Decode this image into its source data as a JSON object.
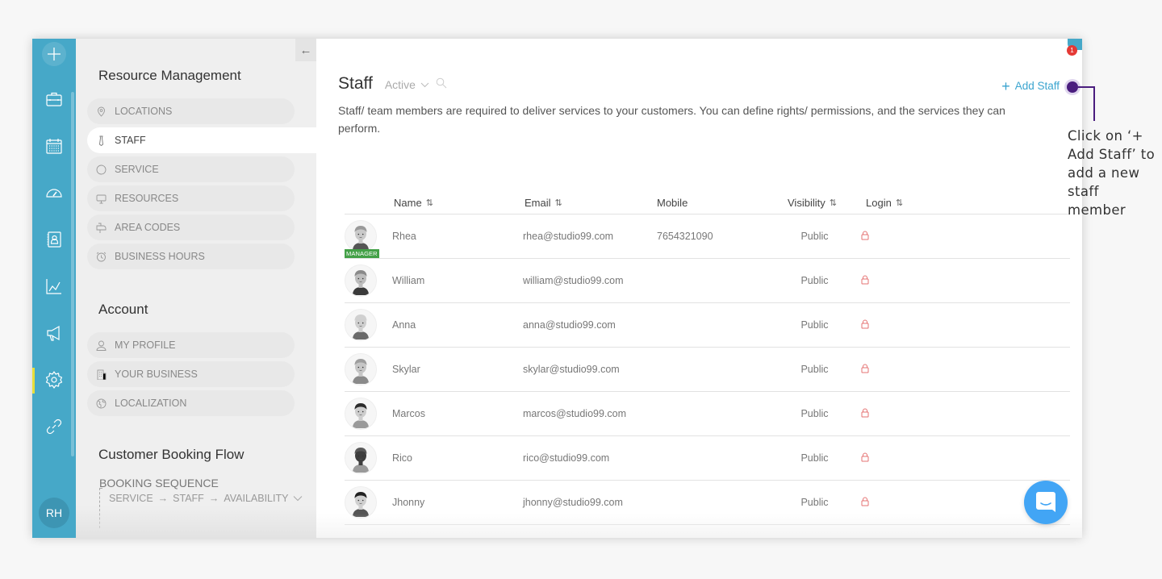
{
  "rail": {
    "items": [
      {
        "name": "briefcase-icon"
      },
      {
        "name": "calendar-icon"
      },
      {
        "name": "dashboard-icon"
      },
      {
        "name": "contacts-icon"
      },
      {
        "name": "analytics-icon"
      },
      {
        "name": "megaphone-icon"
      },
      {
        "name": "settings-icon",
        "active": true
      },
      {
        "name": "link-icon"
      }
    ],
    "user_initials": "RH",
    "active_color": "#e7de3a",
    "bg_color": "#46a8c8"
  },
  "panel": {
    "collapse_icon": "←",
    "resource_title": "Resource Management",
    "resource_items": [
      {
        "label": "LOCATIONS",
        "icon": "location-pin-icon"
      },
      {
        "label": "STAFF",
        "icon": "tie-icon",
        "active": true
      },
      {
        "label": "SERVICE",
        "icon": "circle-icon"
      },
      {
        "label": "RESOURCES",
        "icon": "monitor-icon"
      },
      {
        "label": "AREA CODES",
        "icon": "mailbox-icon"
      },
      {
        "label": "BUSINESS HOURS",
        "icon": "alarm-clock-icon"
      }
    ],
    "account_title": "Account",
    "account_items": [
      {
        "label": "MY PROFILE",
        "icon": "user-icon"
      },
      {
        "label": "YOUR BUSINESS",
        "icon": "building-icon"
      },
      {
        "label": "LOCALIZATION",
        "icon": "globe-icon"
      }
    ],
    "flow_title": "Customer Booking Flow",
    "booking_sequence_label": "BOOKING SEQUENCE",
    "sequence": [
      "SERVICE",
      "STAFF",
      "AVAILABILITY"
    ],
    "arrow": "→"
  },
  "main": {
    "title": "Staff",
    "status_filter": "Active",
    "description": "Staff/ team members are required to deliver services to your customers. You can define rights/ permissions, and the services they can perform.",
    "add_staff_plus": "+",
    "add_staff_label": "Add Staff",
    "notification_count": "1",
    "accent_color": "#3aa4cf"
  },
  "table": {
    "headers": {
      "name": "Name",
      "email": "Email",
      "mobile": "Mobile",
      "visibility": "Visibility",
      "login": "Login",
      "sort_icon": "⇅"
    },
    "manager_badge": "MANAGER",
    "rows": [
      {
        "name": "Rhea",
        "email": "rhea@studio99.com",
        "mobile": "7654321090",
        "visibility": "Public",
        "login": "locked",
        "manager": true
      },
      {
        "name": "William",
        "email": "william@studio99.com",
        "mobile": "",
        "visibility": "Public",
        "login": "locked"
      },
      {
        "name": "Anna",
        "email": "anna@studio99.com",
        "mobile": "",
        "visibility": "Public",
        "login": "locked"
      },
      {
        "name": "Skylar",
        "email": "skylar@studio99.com",
        "mobile": "",
        "visibility": "Public",
        "login": "locked"
      },
      {
        "name": "Marcos",
        "email": "marcos@studio99.com",
        "mobile": "",
        "visibility": "Public",
        "login": "locked"
      },
      {
        "name": "Rico",
        "email": "rico@studio99.com",
        "mobile": "",
        "visibility": "Public",
        "login": "locked"
      },
      {
        "name": "Jhonny",
        "email": "jhonny@studio99.com",
        "mobile": "",
        "visibility": "Public",
        "login": "locked"
      }
    ],
    "lock_color": "#e57373"
  },
  "callout": {
    "text": "Click on ‘+ Add Staff’ to add a new staff member",
    "color": "#4a1d7e"
  }
}
